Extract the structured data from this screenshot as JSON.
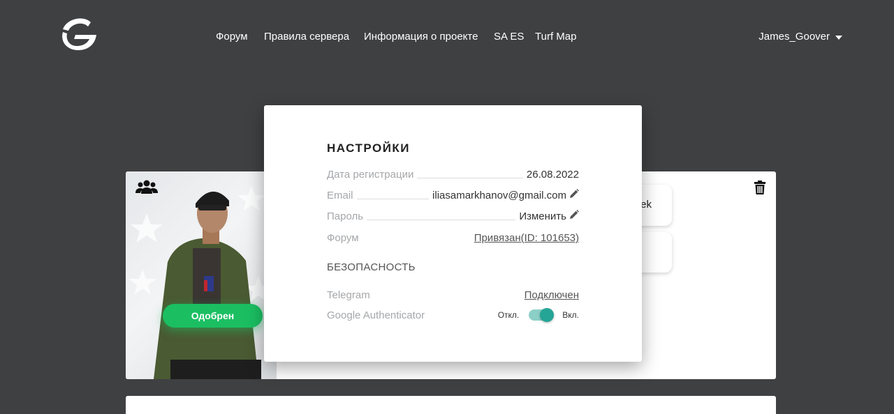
{
  "header": {
    "nav": [
      "Форум",
      "Правила сервера",
      "Информация о проекте",
      "SA ES",
      "Turf Map"
    ],
    "username": "James_Goover"
  },
  "character": {
    "status": "Одобрен",
    "side_text": "ek"
  },
  "settings": {
    "title": "НАСТРОЙКИ",
    "rows": [
      {
        "label": "Дата регистрации",
        "value": "26.08.2022"
      },
      {
        "label": "Email",
        "value": "iliasamarkhanov@gmail.com"
      },
      {
        "label": "Пароль",
        "value": "Изменить"
      },
      {
        "label": "Форум",
        "value": "Привязан(ID: 101653)"
      }
    ],
    "security_title": "БЕЗОПАСНОСТЬ",
    "telegram": {
      "label": "Telegram",
      "value": "Подключен"
    },
    "ga": {
      "label": "Google Authenticator",
      "off": "Откл.",
      "on": "Вкл.",
      "enabled": true
    }
  },
  "colors": {
    "background": "#3f4042",
    "approved": "#1bbf62",
    "toggle": "#25a596"
  }
}
